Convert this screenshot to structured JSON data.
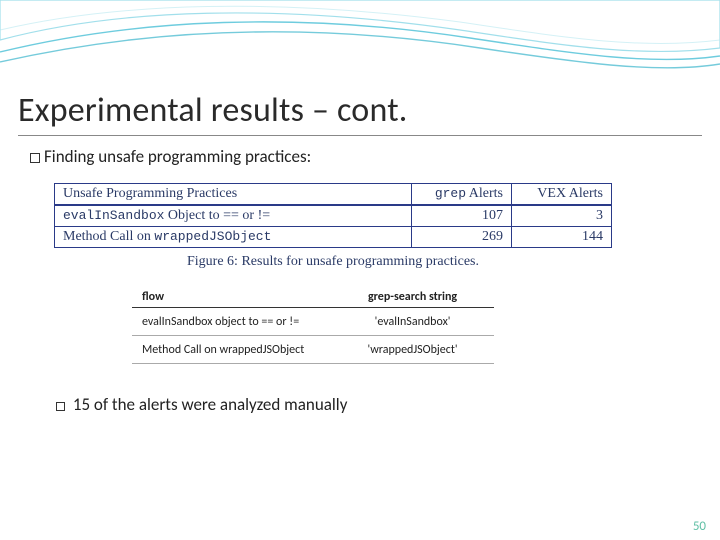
{
  "slide": {
    "title": "Experimental results – cont.",
    "bullet1": "Finding unsafe programming practices:",
    "sub_bullet": "15 of the alerts were analyzed manually",
    "page_number": "50"
  },
  "figure": {
    "caption": "Figure 6: Results for unsafe programming practices.",
    "headers": {
      "col1": "Unsafe Programming Practices",
      "col2_pre": "grep",
      "col2_suf": " Alerts",
      "col3": "VEX Alerts"
    },
    "rows": [
      {
        "c1_pre": "evalInSandbox",
        "c1_suf": " Object to == or !=",
        "c2": "107",
        "c3": "3"
      },
      {
        "c1_pre_plain": "Method Call on ",
        "c1_mono": "wrappedJSObject",
        "c2": "269",
        "c3": "144"
      }
    ]
  },
  "table2": {
    "headers": {
      "c1": "flow",
      "c2": "grep-search string"
    },
    "rows": [
      {
        "c1": "evalInSandbox object to == or !=",
        "c2": "'evalInSandbox'"
      },
      {
        "c1": "Method Call on wrappedJSObject",
        "c2": "'wrappedJSObject'"
      }
    ]
  }
}
